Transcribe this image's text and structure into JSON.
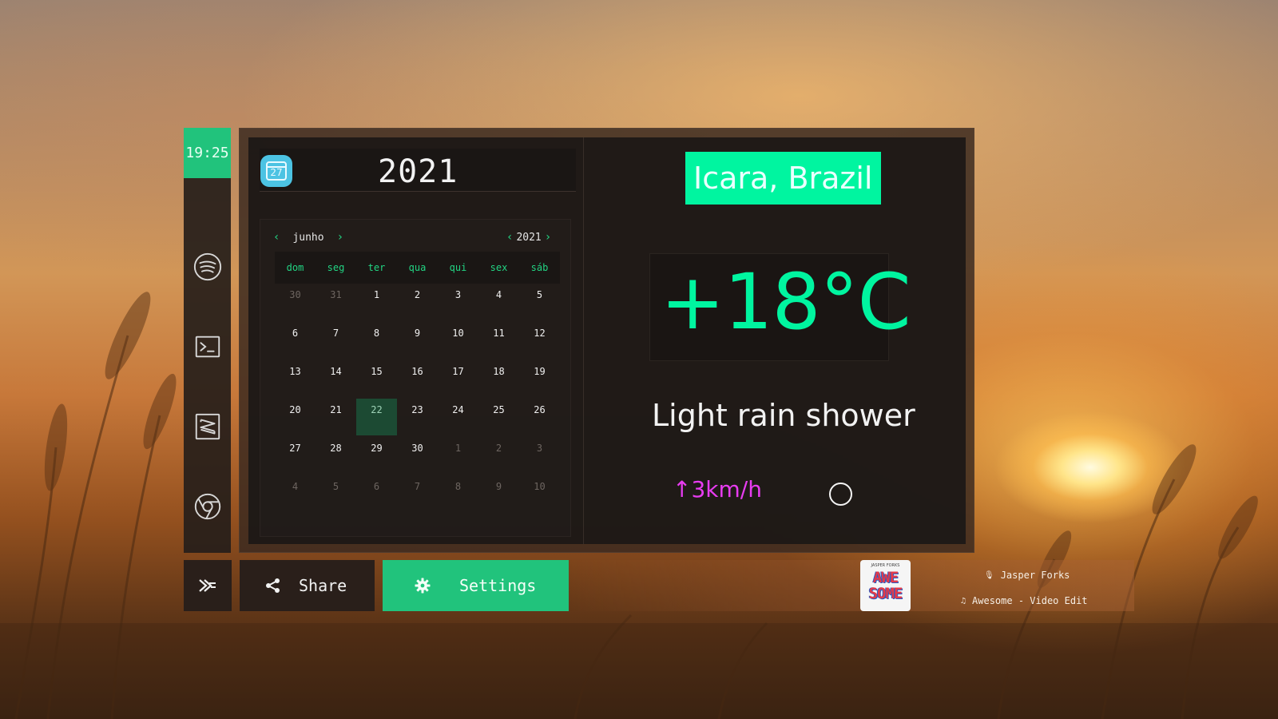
{
  "dock": {
    "clock": "19:25",
    "apps": [
      {
        "name": "spotify-icon"
      },
      {
        "name": "terminal-icon"
      },
      {
        "name": "sublime-text-icon"
      },
      {
        "name": "chrome-icon"
      }
    ]
  },
  "calendar": {
    "icon_label": "27",
    "year_title": "2021",
    "month": "junho",
    "year": "2021",
    "weekdays": [
      "dom",
      "seg",
      "ter",
      "qua",
      "qui",
      "sex",
      "sáb"
    ],
    "weeks": [
      [
        "30",
        "31",
        "1",
        "2",
        "3",
        "4",
        "5"
      ],
      [
        "6",
        "7",
        "8",
        "9",
        "10",
        "11",
        "12"
      ],
      [
        "13",
        "14",
        "15",
        "16",
        "17",
        "18",
        "19"
      ],
      [
        "20",
        "21",
        "22",
        "23",
        "24",
        "25",
        "26"
      ],
      [
        "27",
        "28",
        "29",
        "30",
        "1",
        "2",
        "3"
      ],
      [
        "4",
        "5",
        "6",
        "7",
        "8",
        "9",
        "10"
      ]
    ],
    "today": "22"
  },
  "weather": {
    "city": "Icara, Brazil",
    "temperature": "+18°C",
    "description": "Light rain shower",
    "wind": "↑3km/h"
  },
  "bottom_bar": {
    "share_label": "Share",
    "settings_label": "Settings"
  },
  "media": {
    "album_top": "JASPER FORKS",
    "album_word": "AWE SOME",
    "artist": "Jasper Forks",
    "title": "Awesome - Video Edit"
  },
  "colors": {
    "accent": "#21c37c",
    "weather_accent": "#00f5a0",
    "wind": "#e73cf0"
  }
}
